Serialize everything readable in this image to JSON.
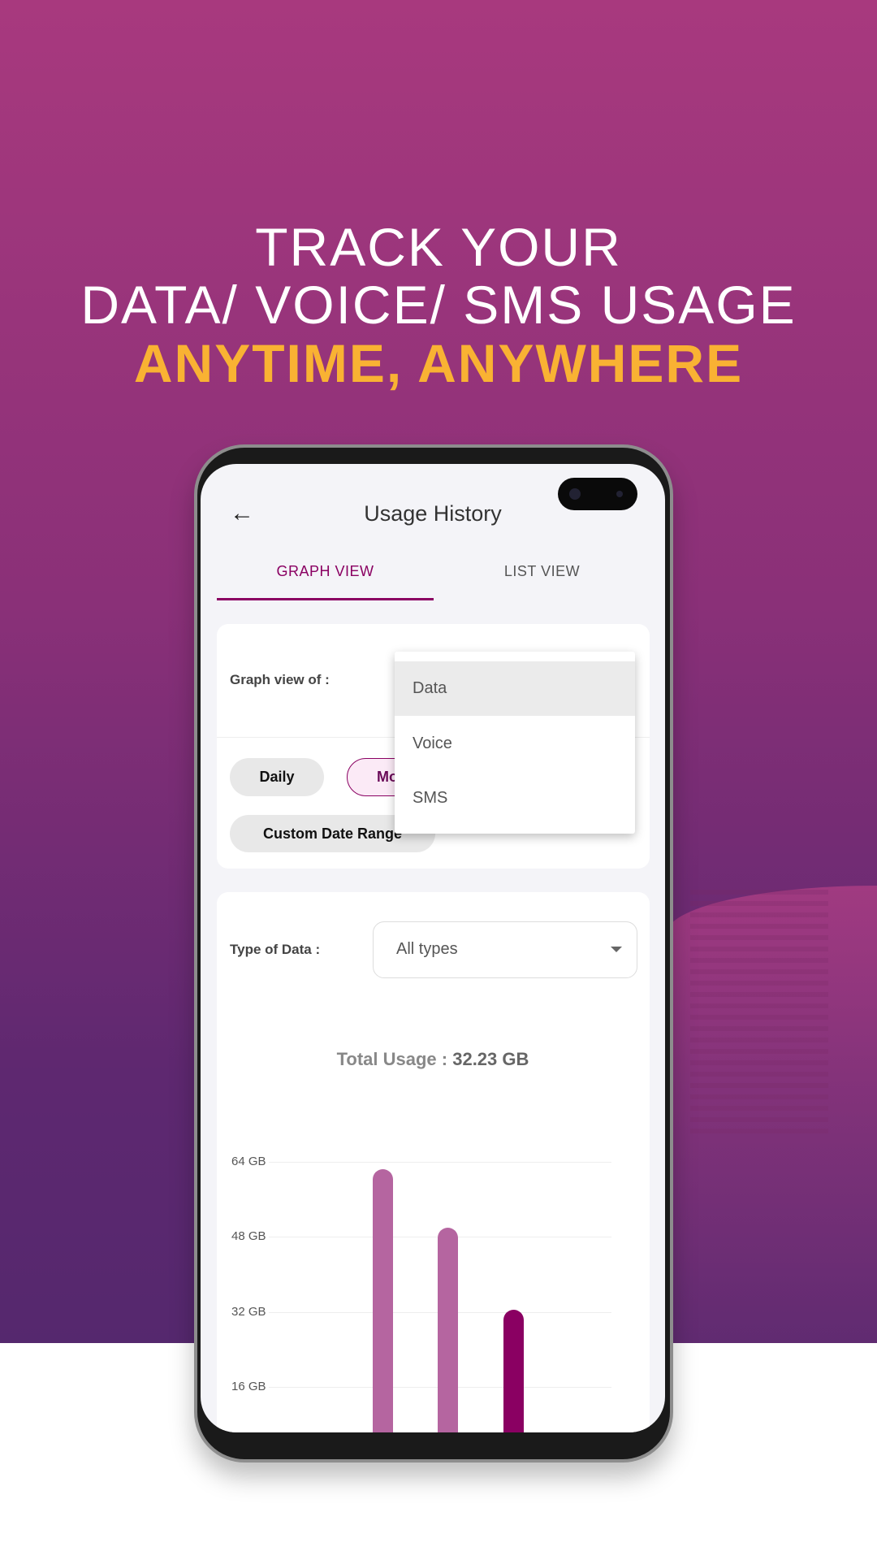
{
  "headline": {
    "line1": "TRACK YOUR",
    "line2": "DATA/ VOICE/ SMS USAGE",
    "line3": "ANYTIME, ANYWHERE"
  },
  "colors": {
    "accent": "#8a0062",
    "headline_highlight": "#f9b233",
    "bar_light": "#b565a0",
    "bar_current": "#8a0062"
  },
  "app": {
    "title": "Usage History",
    "back_icon": "arrow-left-icon",
    "tabs": [
      {
        "label": "GRAPH VIEW",
        "active": true
      },
      {
        "label": "LIST VIEW",
        "active": false
      }
    ],
    "graph_view_label": "Graph view of :",
    "dropdown_options": [
      {
        "label": "Data",
        "highlighted": true
      },
      {
        "label": "Voice"
      },
      {
        "label": "SMS"
      }
    ],
    "period_pills": [
      {
        "label": "Daily"
      },
      {
        "label": "Mo",
        "selected": true
      },
      {
        "label": "Custom Date Range"
      }
    ],
    "type_label": "Type of Data :",
    "type_value": "All types",
    "total_label": "Total Usage : ",
    "total_value": "32.23 GB"
  },
  "chart_data": {
    "type": "bar",
    "y_ticks": [
      "64 GB",
      "48 GB",
      "32 GB",
      "16 GB"
    ],
    "y_tick_values": [
      64,
      48,
      32,
      16
    ],
    "values": [
      62.5,
      50,
      32.5
    ],
    "highlighted_index": 2,
    "grid": true
  }
}
